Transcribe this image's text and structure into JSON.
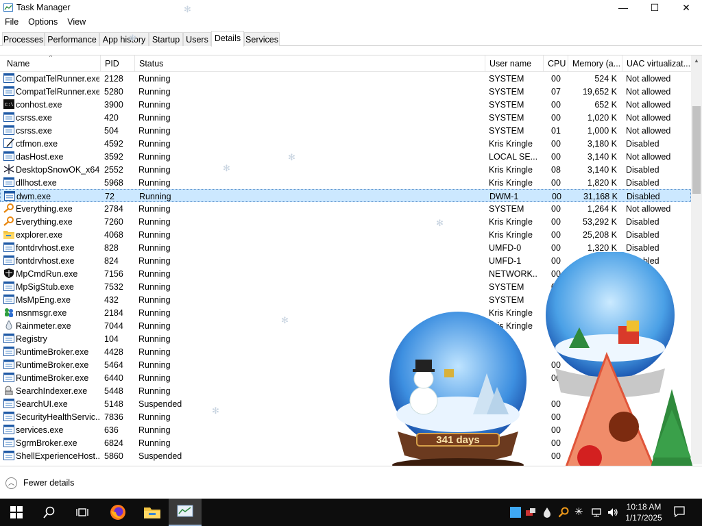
{
  "window": {
    "title": "Task Manager",
    "controls": {
      "minimize": "—",
      "maximize": "☐",
      "close": "✕"
    }
  },
  "menu": [
    "File",
    "Options",
    "View"
  ],
  "tabs": [
    {
      "label": "Processes",
      "active": false
    },
    {
      "label": "Performance",
      "active": false
    },
    {
      "label": "App history",
      "active": false
    },
    {
      "label": "Startup",
      "active": false
    },
    {
      "label": "Users",
      "active": false
    },
    {
      "label": "Details",
      "active": true
    },
    {
      "label": "Services",
      "active": false
    }
  ],
  "columns": {
    "name": "Name",
    "pid": "PID",
    "status": "Status",
    "user": "User name",
    "cpu": "CPU",
    "memory": "Memory (a...",
    "uac": "UAC virtualizat..."
  },
  "processes": [
    {
      "icon": "window-icon",
      "name": "CompatTelRunner.exe",
      "pid": "2128",
      "status": "Running",
      "user": "SYSTEM",
      "cpu": "00",
      "memory": "524 K",
      "uac": "Not allowed"
    },
    {
      "icon": "window-icon",
      "name": "CompatTelRunner.exe",
      "pid": "5280",
      "status": "Running",
      "user": "SYSTEM",
      "cpu": "07",
      "memory": "19,652 K",
      "uac": "Not allowed"
    },
    {
      "icon": "console-icon",
      "name": "conhost.exe",
      "pid": "3900",
      "status": "Running",
      "user": "SYSTEM",
      "cpu": "00",
      "memory": "652 K",
      "uac": "Not allowed"
    },
    {
      "icon": "window-icon",
      "name": "csrss.exe",
      "pid": "420",
      "status": "Running",
      "user": "SYSTEM",
      "cpu": "00",
      "memory": "1,020 K",
      "uac": "Not allowed"
    },
    {
      "icon": "window-icon",
      "name": "csrss.exe",
      "pid": "504",
      "status": "Running",
      "user": "SYSTEM",
      "cpu": "01",
      "memory": "1,000 K",
      "uac": "Not allowed"
    },
    {
      "icon": "pen-icon",
      "name": "ctfmon.exe",
      "pid": "4592",
      "status": "Running",
      "user": "Kris Kringle",
      "cpu": "00",
      "memory": "3,180 K",
      "uac": "Disabled"
    },
    {
      "icon": "window-icon",
      "name": "dasHost.exe",
      "pid": "3592",
      "status": "Running",
      "user": "LOCAL SE...",
      "cpu": "00",
      "memory": "3,140 K",
      "uac": "Not allowed"
    },
    {
      "icon": "snowflake-icon",
      "name": "DesktopSnowOK_x64...",
      "pid": "2552",
      "status": "Running",
      "user": "Kris Kringle",
      "cpu": "08",
      "memory": "3,140 K",
      "uac": "Disabled"
    },
    {
      "icon": "window-icon",
      "name": "dllhost.exe",
      "pid": "5968",
      "status": "Running",
      "user": "Kris Kringle",
      "cpu": "00",
      "memory": "1,820 K",
      "uac": "Disabled"
    },
    {
      "icon": "window-icon",
      "name": "dwm.exe",
      "pid": "72",
      "status": "Running",
      "user": "DWM-1",
      "cpu": "00",
      "memory": "31,168 K",
      "uac": "Disabled",
      "selected": true
    },
    {
      "icon": "magnifier-icon",
      "name": "Everything.exe",
      "pid": "2784",
      "status": "Running",
      "user": "SYSTEM",
      "cpu": "00",
      "memory": "1,264 K",
      "uac": "Not allowed"
    },
    {
      "icon": "magnifier-icon",
      "name": "Everything.exe",
      "pid": "7260",
      "status": "Running",
      "user": "Kris Kringle",
      "cpu": "00",
      "memory": "53,292 K",
      "uac": "Disabled"
    },
    {
      "icon": "folder-icon",
      "name": "explorer.exe",
      "pid": "4068",
      "status": "Running",
      "user": "Kris Kringle",
      "cpu": "00",
      "memory": "25,208 K",
      "uac": "Disabled"
    },
    {
      "icon": "window-icon",
      "name": "fontdrvhost.exe",
      "pid": "828",
      "status": "Running",
      "user": "UMFD-0",
      "cpu": "00",
      "memory": "1,320 K",
      "uac": "Disabled"
    },
    {
      "icon": "window-icon",
      "name": "fontdrvhost.exe",
      "pid": "824",
      "status": "Running",
      "user": "UMFD-1",
      "cpu": "00",
      "memory": "",
      "uac": "Disabled"
    },
    {
      "icon": "shield-icon",
      "name": "MpCmdRun.exe",
      "pid": "7156",
      "status": "Running",
      "user": "NETWORK...",
      "cpu": "00",
      "memory": "",
      "uac": ""
    },
    {
      "icon": "window-icon",
      "name": "MpSigStub.exe",
      "pid": "7532",
      "status": "Running",
      "user": "SYSTEM",
      "cpu": "00",
      "memory": "",
      "uac": ""
    },
    {
      "icon": "window-icon",
      "name": "MsMpEng.exe",
      "pid": "432",
      "status": "Running",
      "user": "SYSTEM",
      "cpu": "",
      "memory": "",
      "uac": ""
    },
    {
      "icon": "messenger-icon",
      "name": "msnmsgr.exe",
      "pid": "2184",
      "status": "Running",
      "user": "Kris Kringle",
      "cpu": "",
      "memory": "",
      "uac": ""
    },
    {
      "icon": "drop-icon",
      "name": "Rainmeter.exe",
      "pid": "7044",
      "status": "Running",
      "user": "Kris Kringle",
      "cpu": "",
      "memory": "",
      "uac": ""
    },
    {
      "icon": "window-icon",
      "name": "Registry",
      "pid": "104",
      "status": "Running",
      "user": "",
      "cpu": "",
      "memory": "",
      "uac": ""
    },
    {
      "icon": "window-icon",
      "name": "RuntimeBroker.exe",
      "pid": "4428",
      "status": "Running",
      "user": "",
      "cpu": "",
      "memory": "",
      "uac": ""
    },
    {
      "icon": "window-icon",
      "name": "RuntimeBroker.exe",
      "pid": "5464",
      "status": "Running",
      "user": "",
      "cpu": "00",
      "memory": "",
      "uac": ""
    },
    {
      "icon": "window-icon",
      "name": "RuntimeBroker.exe",
      "pid": "6440",
      "status": "Running",
      "user": "",
      "cpu": "00",
      "memory": "",
      "uac": ""
    },
    {
      "icon": "search-indexer-icon",
      "name": "SearchIndexer.exe",
      "pid": "5448",
      "status": "Running",
      "user": "",
      "cpu": "",
      "memory": "",
      "uac": ""
    },
    {
      "icon": "window-icon",
      "name": "SearchUI.exe",
      "pid": "5148",
      "status": "Suspended",
      "user": "",
      "cpu": "00",
      "memory": "",
      "uac": ""
    },
    {
      "icon": "window-icon",
      "name": "SecurityHealthServic...",
      "pid": "7836",
      "status": "Running",
      "user": "",
      "cpu": "00",
      "memory": "",
      "uac": ""
    },
    {
      "icon": "window-icon",
      "name": "services.exe",
      "pid": "636",
      "status": "Running",
      "user": "",
      "cpu": "00",
      "memory": "",
      "uac": ""
    },
    {
      "icon": "window-icon",
      "name": "SgrmBroker.exe",
      "pid": "6824",
      "status": "Running",
      "user": "",
      "cpu": "00",
      "memory": "",
      "uac": ""
    },
    {
      "icon": "window-icon",
      "name": "ShellExperienceHost....",
      "pid": "5860",
      "status": "Suspended",
      "user": "",
      "cpu": "00",
      "memory": "",
      "uac": ""
    }
  ],
  "footer": {
    "fewer_details": "Fewer details"
  },
  "globe": {
    "countdown": "341 days"
  },
  "taskbar": {
    "items": [
      "windows-start-icon",
      "search-icon",
      "task-view-icon",
      "firefox-icon",
      "file-explorer-icon",
      "task-manager-icon"
    ],
    "tray": [
      "app-square-icon",
      "network-app-icon",
      "drop-icon",
      "magnifier-icon",
      "snowflake-icon",
      "network-icon",
      "volume-icon"
    ],
    "time": "10:18 AM",
    "date": "1/17/2025"
  },
  "colors": {
    "selection_bg": "#cce8ff",
    "taskbar_bg": "#0d0d0d"
  }
}
